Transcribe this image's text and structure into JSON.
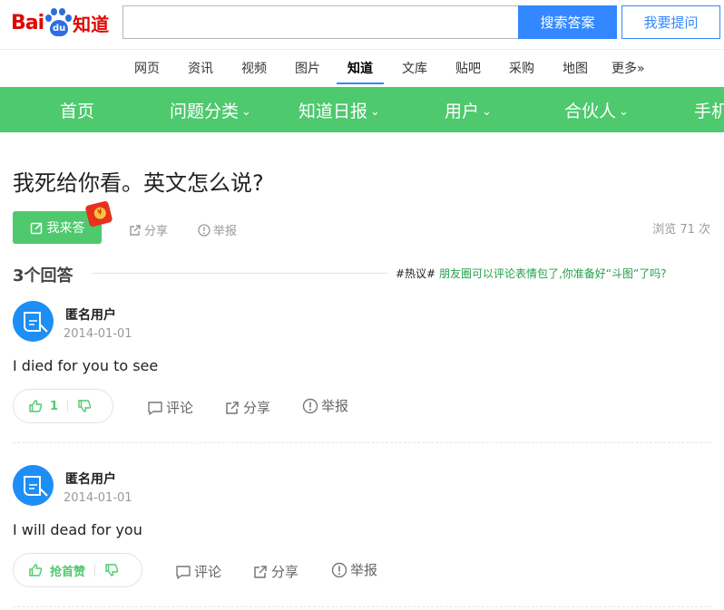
{
  "header": {
    "logo_bai": "Bai",
    "logo_du": "du",
    "logo_zhidao": "知道",
    "search_placeholder": "",
    "search_button": "搜索答案",
    "ask_button": "我要提问"
  },
  "channels": [
    "网页",
    "资讯",
    "视频",
    "图片",
    "知道",
    "文库",
    "贴吧",
    "采购",
    "地图",
    "更多»"
  ],
  "active_channel": "知道",
  "greenbar": {
    "items": [
      "首页",
      "问题分类",
      "知道日报",
      "用户",
      "合伙人",
      "手机"
    ]
  },
  "question": {
    "title": "我死给你看。英文怎么说?",
    "answer_button": "我来答",
    "share": "分享",
    "report": "举报",
    "views": "浏览 71 次"
  },
  "answers_header": {
    "count": "3个回答",
    "hot_tag": "#热议#",
    "hot_text": "朋友圈可以评论表情包了,你准备好“斗图”了吗?"
  },
  "answers": [
    {
      "user": "匿名用户",
      "date": "2014-01-01",
      "text": "I died for you to see",
      "vote_label": "1",
      "comment": "评论",
      "share": "分享",
      "report": "举报"
    },
    {
      "user": "匿名用户",
      "date": "2014-01-01",
      "text": "I will dead for you",
      "vote_label": "抢首赞",
      "comment": "评论",
      "share": "分享",
      "report": "举报"
    }
  ],
  "colors": {
    "brand_blue": "#3388ff",
    "green": "#4ec96d",
    "logo_red": "#e10602"
  }
}
